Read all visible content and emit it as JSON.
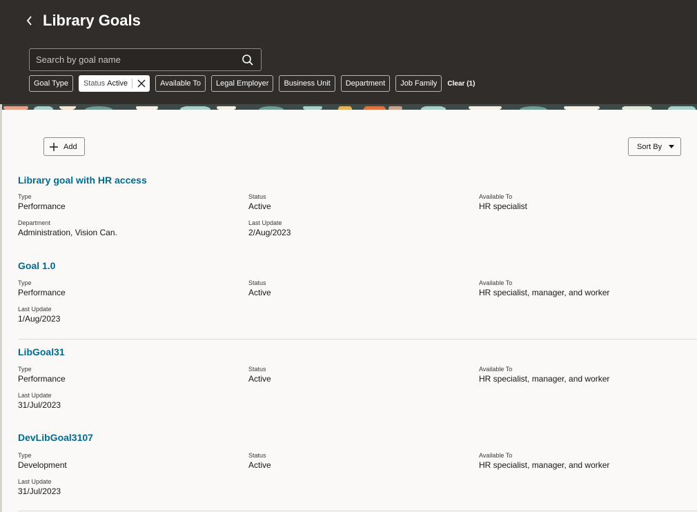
{
  "header": {
    "title": "Library Goals",
    "search_placeholder": "Search by goal name"
  },
  "filters": {
    "goal_type": "Goal Type",
    "status_key": "Status",
    "status_value": "Active",
    "available_to": "Available To",
    "legal_employer": "Legal Employer",
    "business_unit": "Business Unit",
    "department": "Department",
    "job_family": "Job Family",
    "clear": "Clear (1)"
  },
  "toolbar": {
    "add_label": "Add",
    "sort_label": "Sort By"
  },
  "labels": {
    "type": "Type",
    "status": "Status",
    "available_to": "Available To",
    "department": "Department",
    "last_update": "Last Update"
  },
  "goals": [
    {
      "title": "Library goal with HR access",
      "type": "Performance",
      "status": "Active",
      "available_to": "HR specialist",
      "department": "Administration, Vision Can.",
      "last_update": "2/Aug/2023"
    },
    {
      "title": "Goal 1.0",
      "type": "Performance",
      "status": "Active",
      "available_to": "HR specialist, manager, and worker",
      "last_update": "1/Aug/2023"
    },
    {
      "title": "LibGoal31",
      "type": "Performance",
      "status": "Active",
      "available_to": "HR specialist, manager, and worker",
      "last_update": "31/Jul/2023"
    },
    {
      "title": "DevLibGoal3107",
      "type": "Development",
      "status": "Active",
      "available_to": "HR specialist, manager, and worker",
      "last_update": "31/Jul/2023"
    }
  ],
  "colors": {
    "header_bg": "#312d2a",
    "link": "#006b8f",
    "content_bg": "#faf9f7"
  }
}
